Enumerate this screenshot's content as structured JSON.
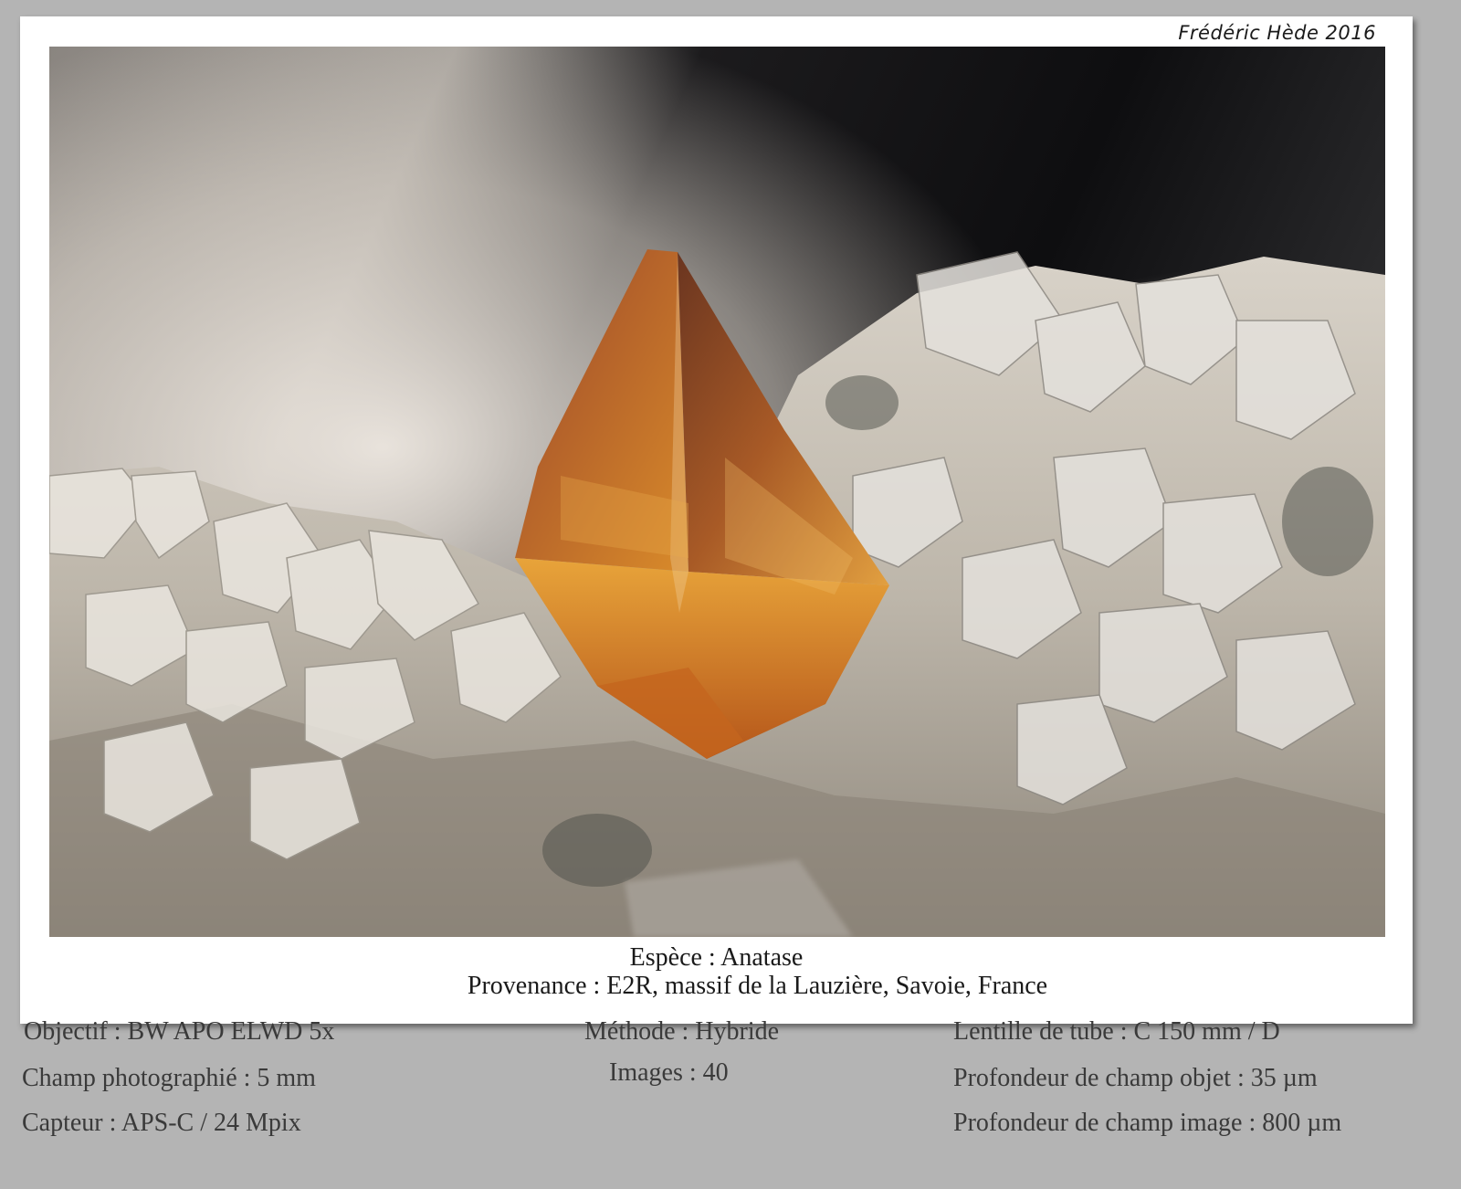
{
  "credit": "Frédéric Hède 2016",
  "caption": {
    "species": "Espèce : Anatase",
    "origin": "Provenance : E2R, massif de la Lauzière, Savoie, France"
  },
  "specs": {
    "col1": [
      "Objectif : BW APO ELWD 5x",
      "Champ photographié : 5 mm",
      "Capteur : APS-C / 24 Mpix"
    ],
    "col2": [
      "Méthode : Hybride",
      "Images : 40"
    ],
    "col3": [
      "Lentille de tube : C 150 mm / D",
      "Profondeur de champ objet : 35 µm",
      "Profondeur de champ image : 800 µm"
    ]
  },
  "colors": {
    "background": "#b4b4b4",
    "card": "#ffffff",
    "crystal": "#b8651c"
  }
}
